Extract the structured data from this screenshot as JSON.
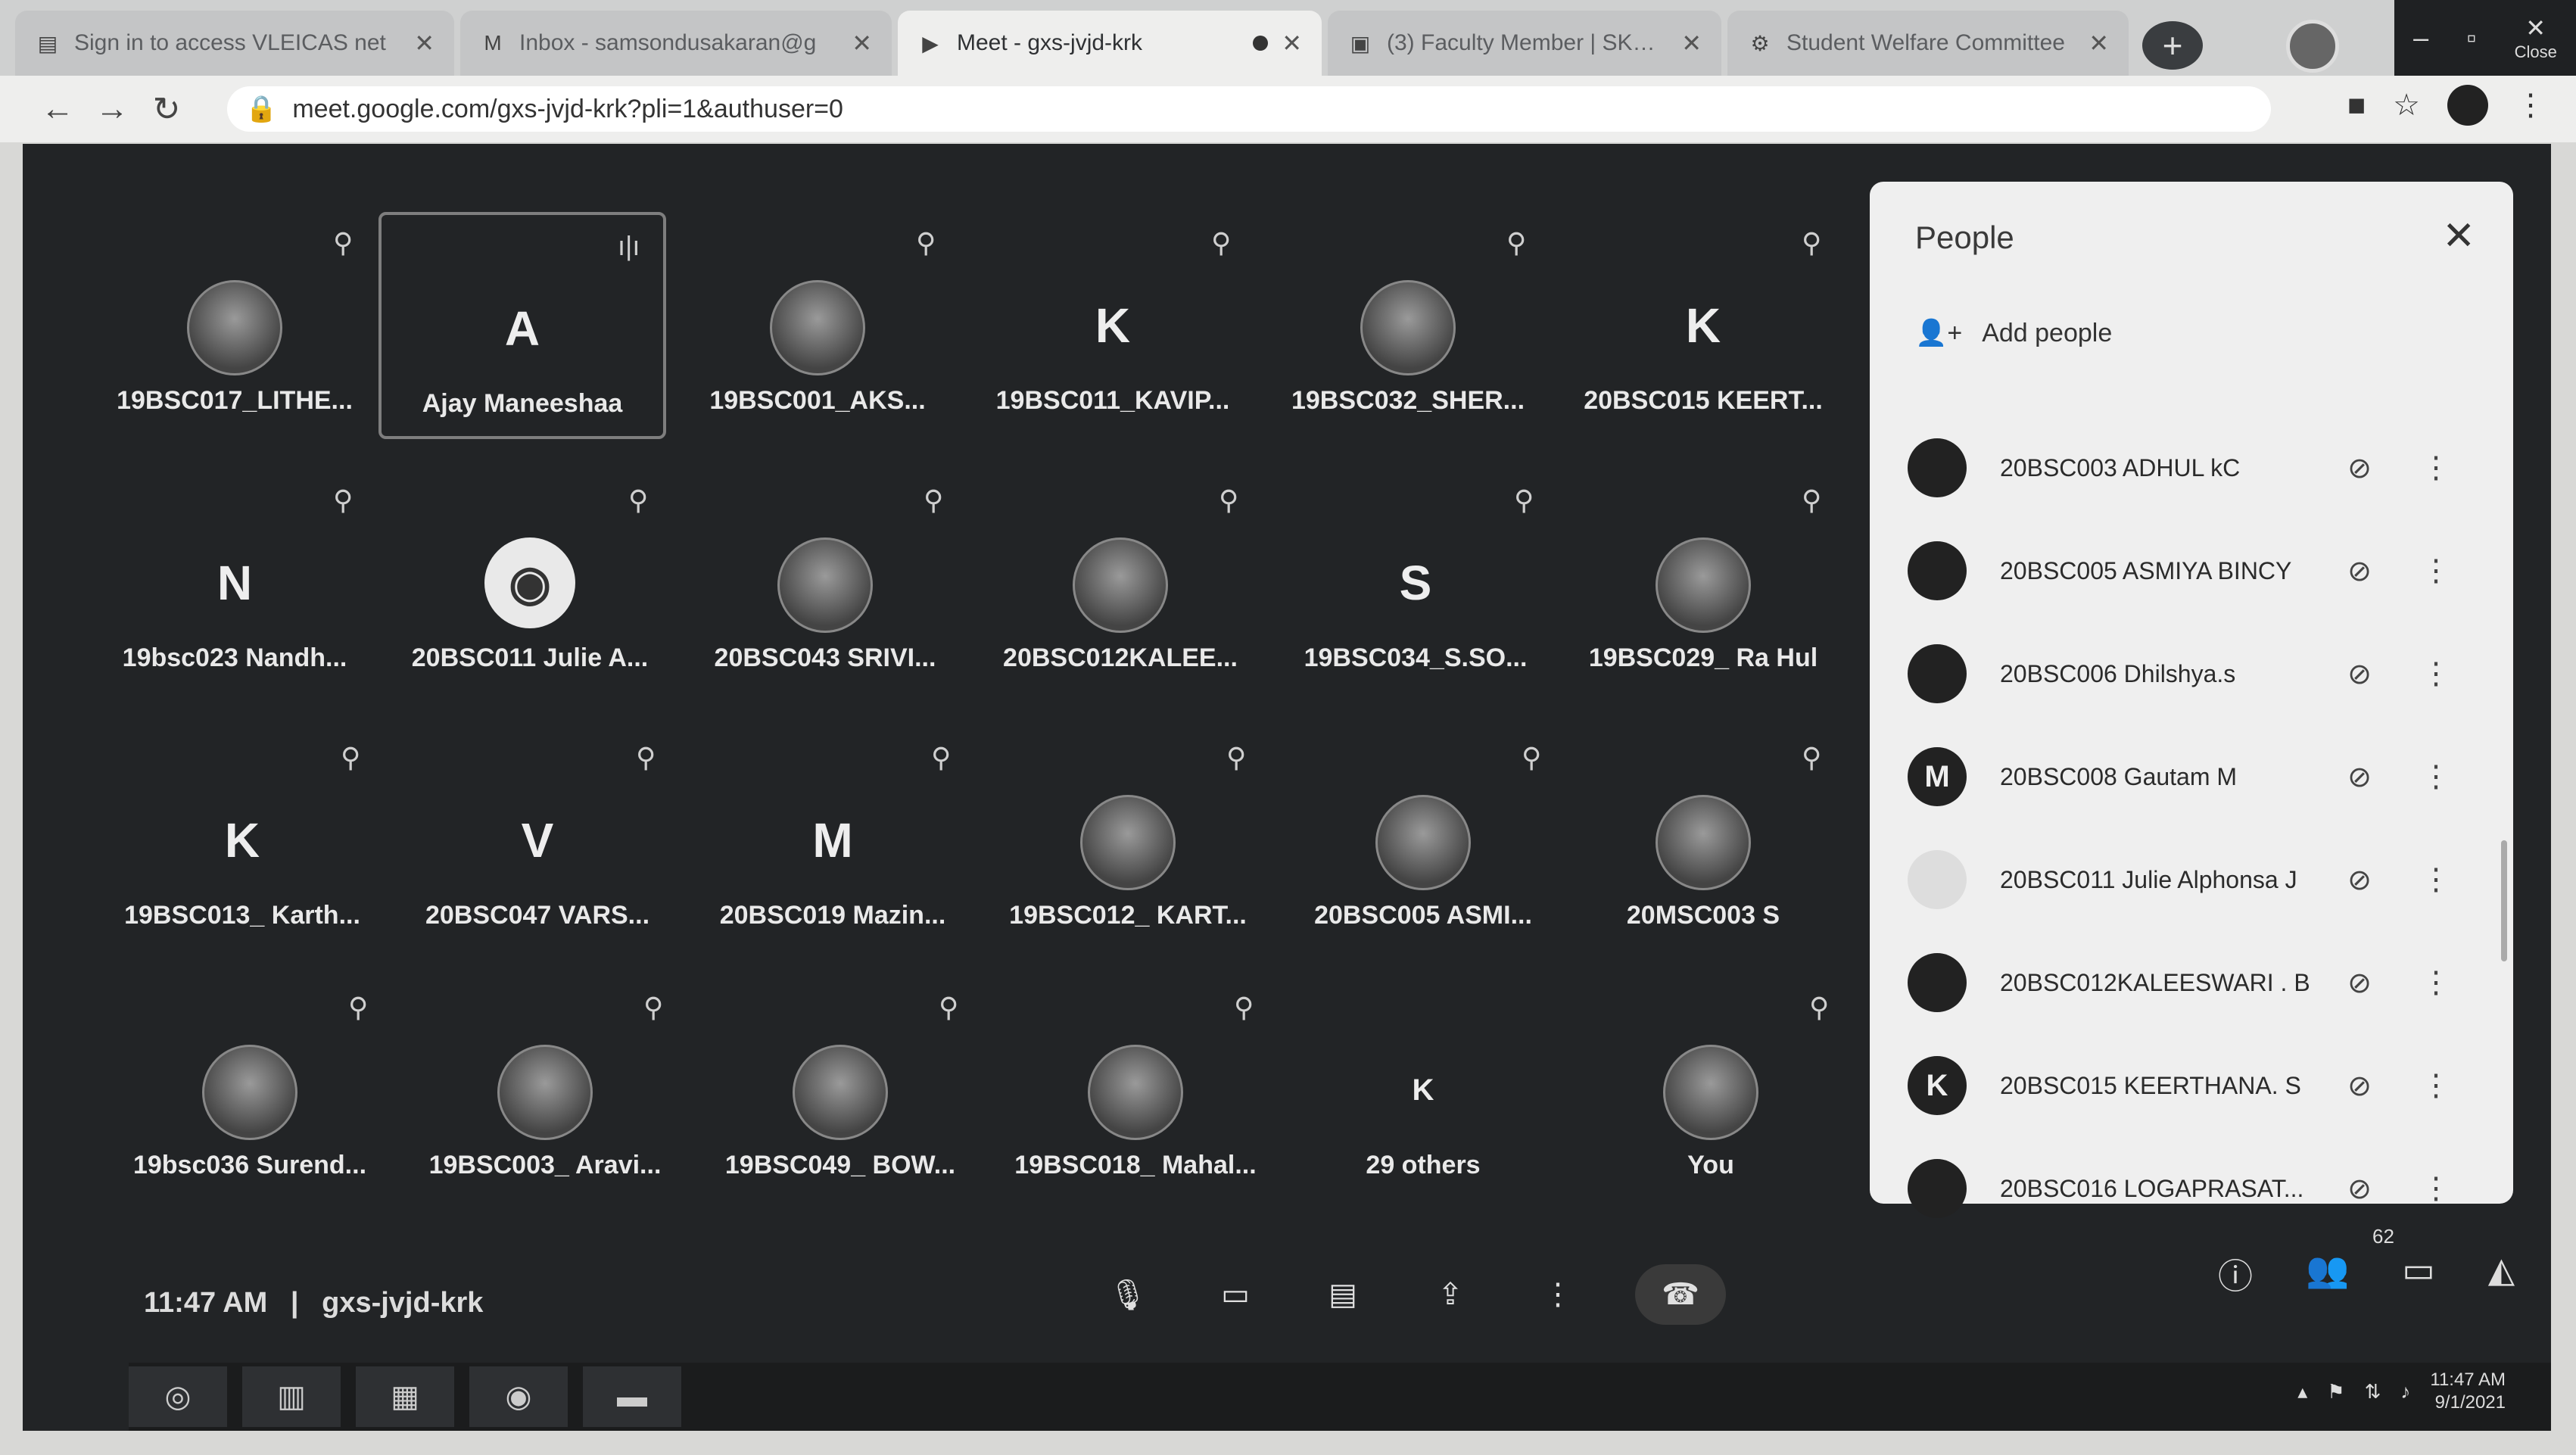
{
  "browser": {
    "tabs": [
      {
        "title": "Sign in to access VLEICAS net",
        "icon": "document-icon",
        "active": false
      },
      {
        "title": "Inbox - samsondusakaran@g",
        "icon": "gmail-icon",
        "active": false
      },
      {
        "title": "Meet - gxs-jvjd-krk",
        "icon": "meet-icon",
        "active": true,
        "recording": true
      },
      {
        "title": "(3) Faculty Member | SKYJET",
        "icon": "page-icon",
        "active": false
      },
      {
        "title": "Student Welfare Committee",
        "icon": "gear-icon",
        "active": false
      }
    ],
    "close_tooltip": "Close",
    "url": "meet.google.com/gxs-jvjd-krk?pli=1&authuser=0"
  },
  "meet": {
    "tiles": [
      {
        "name": "19BSC017_LITHE...",
        "avatar": "photo"
      },
      {
        "name": "Ajay Maneeshaa",
        "avatar": "A",
        "speaking": true
      },
      {
        "name": "19BSC001_AKS...",
        "avatar": "photo"
      },
      {
        "name": "19BSC011_KAVIP...",
        "avatar": "K"
      },
      {
        "name": "19BSC032_SHER...",
        "avatar": "photo"
      },
      {
        "name": "20BSC015 KEERT...",
        "avatar": "K"
      },
      {
        "name": "19bsc023 Nandh...",
        "avatar": "N"
      },
      {
        "name": "20BSC011 Julie A...",
        "avatar": "logo"
      },
      {
        "name": "20BSC043 SRIVI...",
        "avatar": "photo"
      },
      {
        "name": "20BSC012KALEE...",
        "avatar": "photo"
      },
      {
        "name": "19BSC034_S.SO...",
        "avatar": "S"
      },
      {
        "name": "19BSC029_ Ra Hul",
        "avatar": "photo"
      },
      {
        "name": "19BSC013_ Karth...",
        "avatar": "K"
      },
      {
        "name": "20BSC047 VARS...",
        "avatar": "V"
      },
      {
        "name": "20BSC019 Mazin...",
        "avatar": "M"
      },
      {
        "name": "19BSC012_ KART...",
        "avatar": "photo"
      },
      {
        "name": "20BSC005 ASMI...",
        "avatar": "photo"
      },
      {
        "name": "20MSC003 S",
        "avatar": "photo"
      },
      {
        "name": "19bsc036 Surend...",
        "avatar": "photo"
      },
      {
        "name": "19BSC003_ Aravi...",
        "avatar": "photo"
      },
      {
        "name": "19BSC049_ BOW...",
        "avatar": "photo"
      },
      {
        "name": "19BSC018_ Mahal...",
        "avatar": "photo"
      },
      {
        "name": "29 others",
        "avatar": "K"
      },
      {
        "name": "You",
        "avatar": "photo"
      }
    ],
    "time": "11:47 AM",
    "separator": "|",
    "meeting_code": "gxs-jvjd-krk",
    "participant_count": "62"
  },
  "people_panel": {
    "title": "People",
    "add_people": "Add people",
    "participants": [
      {
        "name": "20BSC003 ADHUL kC",
        "avatar": ""
      },
      {
        "name": "20BSC005 ASMIYA BINCY",
        "avatar": ""
      },
      {
        "name": "20BSC006 Dhilshya.s",
        "avatar": ""
      },
      {
        "name": "20BSC008 Gautam M",
        "avatar": "M"
      },
      {
        "name": "20BSC011 Julie Alphonsa J",
        "avatar": ""
      },
      {
        "name": "20BSC012KALEESWARI . B",
        "avatar": ""
      },
      {
        "name": "20BSC015 KEERTHANA. S",
        "avatar": "K"
      },
      {
        "name": "20BSC016 LOGAPRASAT...",
        "avatar": ""
      }
    ]
  },
  "taskbar": {
    "time": "11:47 AM",
    "date": "9/1/2021"
  }
}
